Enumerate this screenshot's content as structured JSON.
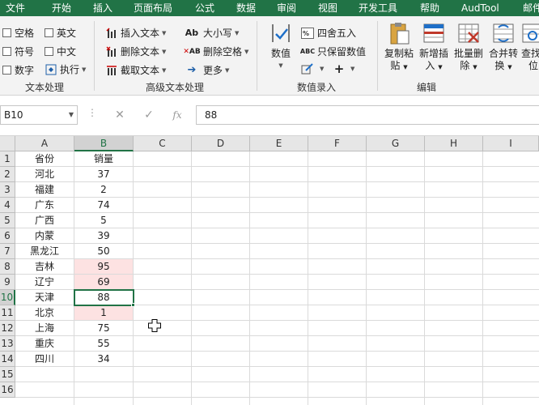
{
  "menu": [
    "文件",
    "开始",
    "插入",
    "页面布局",
    "公式",
    "数据",
    "审阅",
    "视图",
    "开发工具",
    "帮助",
    "AudTool",
    "邮件"
  ],
  "ribbon": {
    "text_processing": {
      "label": "文本处理",
      "options": [
        "空格",
        "英文",
        "符号",
        "中文",
        "数字",
        "执行"
      ]
    },
    "advanced_text": {
      "label": "高级文本处理",
      "items": [
        "插入文本",
        "删除文本",
        "截取文本",
        "大小写",
        "删除空格",
        "更多"
      ]
    },
    "number_entry": {
      "label": "数值录入",
      "big": "数值",
      "items": [
        "四舍五入",
        "只保留数值"
      ]
    },
    "edit": {
      "label": "编辑",
      "buttons": [
        {
          "l1": "复制粘",
          "l2": "贴"
        },
        {
          "l1": "新增插",
          "l2": "入"
        },
        {
          "l1": "批量删",
          "l2": "除"
        },
        {
          "l1": "合并转",
          "l2": "换"
        },
        {
          "l1": "查找定",
          "l2": "位"
        }
      ]
    }
  },
  "formula_bar": {
    "name_box": "B10",
    "fx": "fx",
    "value": "88"
  },
  "columns": [
    "A",
    "B",
    "C",
    "D",
    "E",
    "F",
    "G",
    "H",
    "I"
  ],
  "rows": [
    "1",
    "2",
    "3",
    "4",
    "5",
    "6",
    "7",
    "8",
    "9",
    "10",
    "11",
    "12",
    "13",
    "14",
    "15",
    "16"
  ],
  "table": [
    {
      "a": "省份",
      "b": "销量"
    },
    {
      "a": "河北",
      "b": "37"
    },
    {
      "a": "福建",
      "b": "2"
    },
    {
      "a": "广东",
      "b": "74"
    },
    {
      "a": "广西",
      "b": "5"
    },
    {
      "a": "内蒙",
      "b": "39"
    },
    {
      "a": "黑龙江",
      "b": "50"
    },
    {
      "a": "吉林",
      "b": "95"
    },
    {
      "a": "辽宁",
      "b": "69"
    },
    {
      "a": "天津",
      "b": "88"
    },
    {
      "a": "北京",
      "b": "1"
    },
    {
      "a": "上海",
      "b": "75"
    },
    {
      "a": "重庆",
      "b": "55"
    },
    {
      "a": "四川",
      "b": "34"
    }
  ],
  "colors": {
    "accent": "#217346",
    "highlight": "#fde2e2"
  }
}
